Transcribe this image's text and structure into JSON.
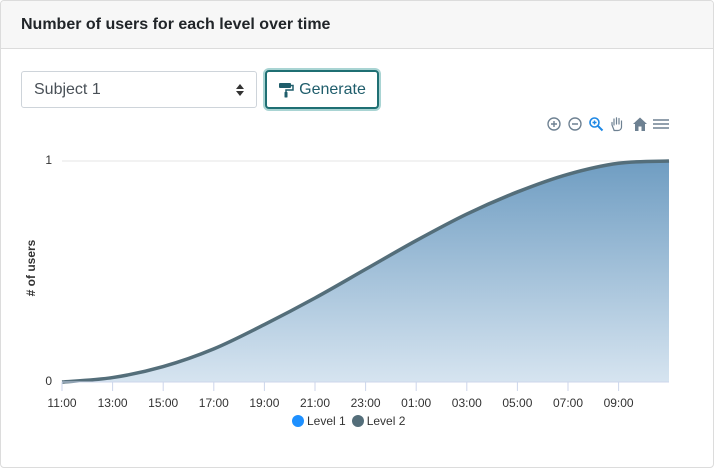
{
  "header": {
    "title": "Number of users for each level over time"
  },
  "controls": {
    "subject_value": "Subject 1",
    "generate_label": "Generate"
  },
  "toolbar": {
    "icons": [
      "zoom-in-icon",
      "zoom-out-icon",
      "zoom-select-icon",
      "pan-hand-icon",
      "home-reset-icon",
      "menu-icon"
    ]
  },
  "colors": {
    "accent": "#1f6f73",
    "level1": "#1e90ff",
    "level2": "#546e7a",
    "area_top": "#6f9dc2",
    "area_bottom": "#d6e4f0"
  },
  "chart_data": {
    "type": "area",
    "title": "",
    "xlabel": "",
    "ylabel": "# of users",
    "x": [
      "11:00",
      "13:00",
      "15:00",
      "17:00",
      "19:00",
      "21:00",
      "23:00",
      "01:00",
      "03:00",
      "05:00",
      "07:00",
      "09:00"
    ],
    "ytick_labels": [
      "0",
      "1"
    ],
    "ylim": [
      0,
      1
    ],
    "series": [
      {
        "name": "Level 1",
        "values": []
      },
      {
        "name": "Level 2",
        "values": [
          0,
          0.02,
          0.07,
          0.15,
          0.26,
          0.38,
          0.51,
          0.64,
          0.76,
          0.86,
          0.94,
          0.99
        ]
      }
    ],
    "grid": true,
    "legend": "bottom-center"
  }
}
